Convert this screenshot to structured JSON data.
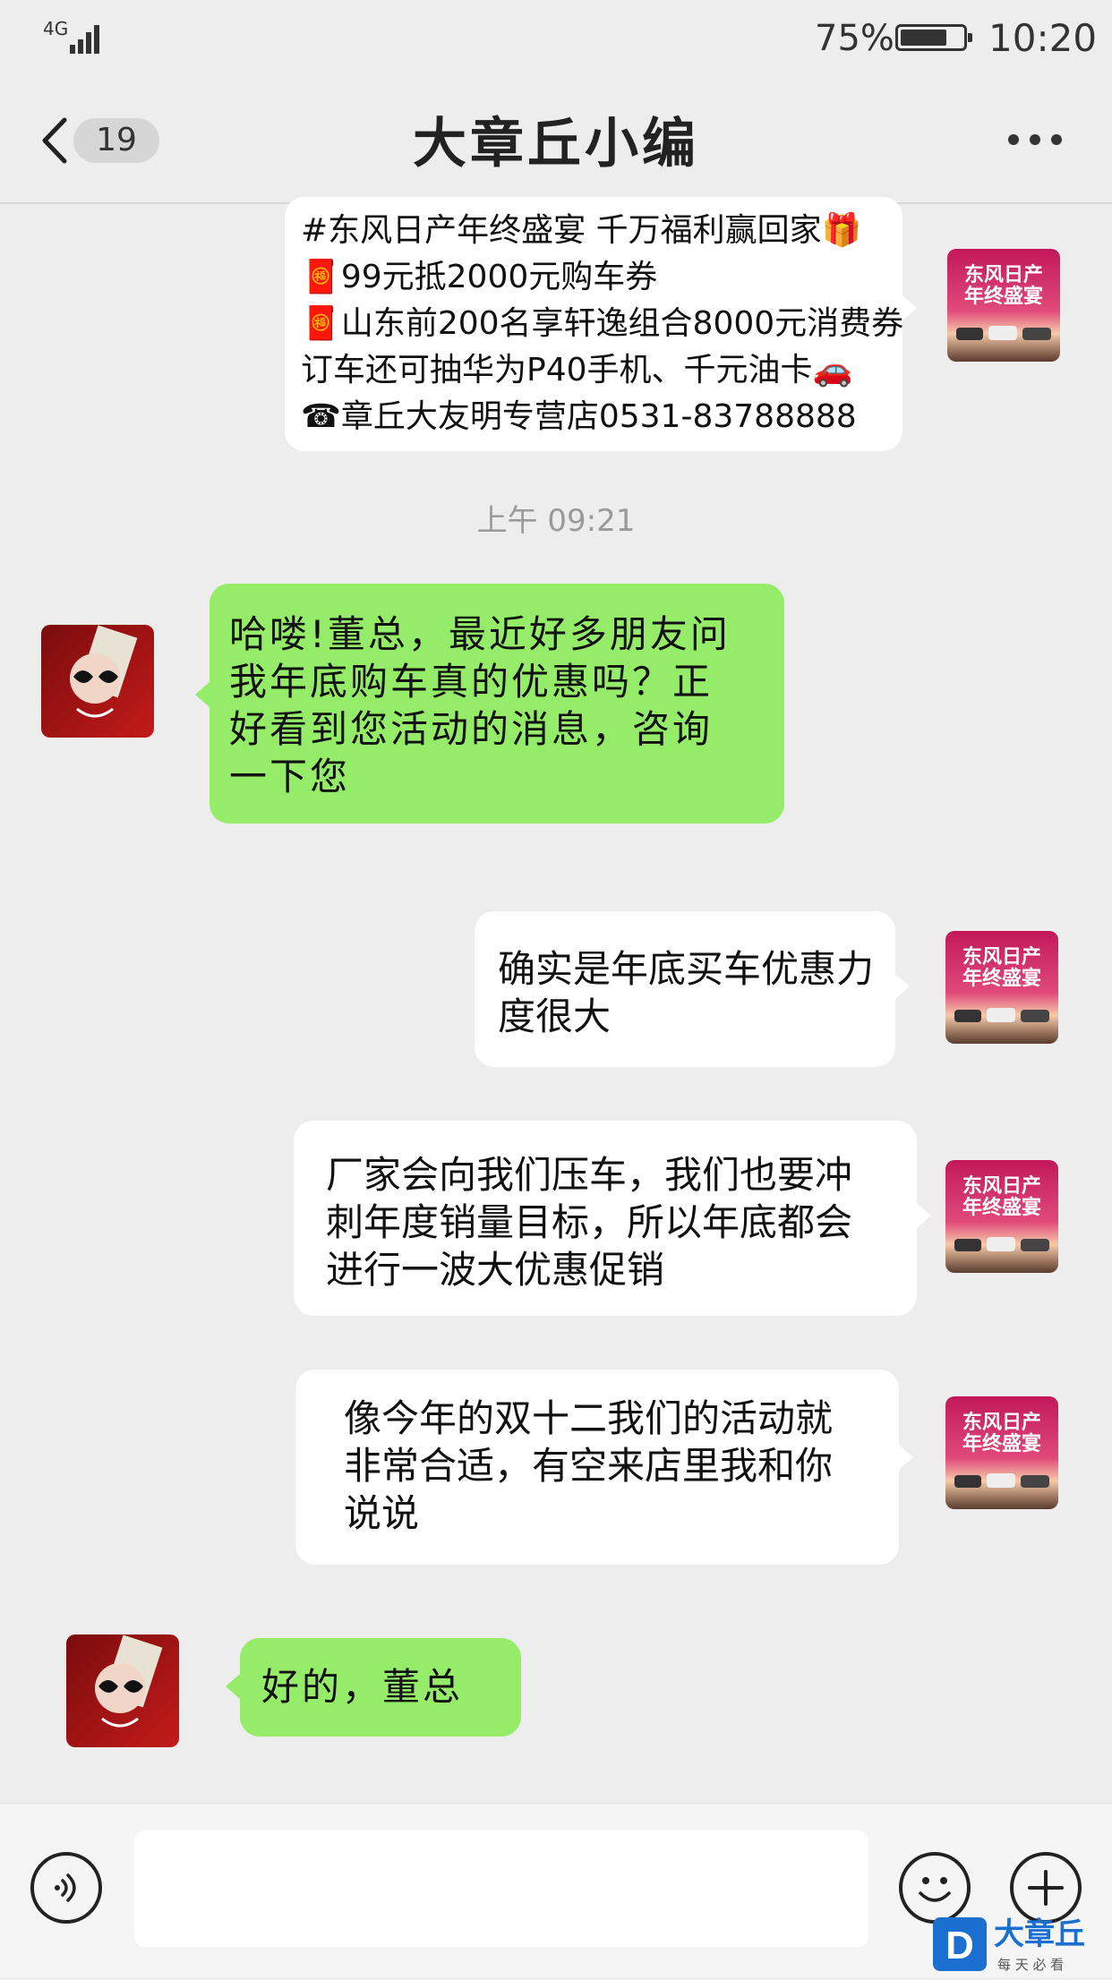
{
  "status_bar": {
    "network": "4G",
    "battery_percent_text": "75%",
    "battery_level": 0.75,
    "time": "10:20"
  },
  "nav": {
    "back_icon": "chevron-left-icon",
    "unread_count": "19",
    "title": "大章丘小编",
    "more_icon": "more-dots-icon"
  },
  "messages": [
    {
      "side": "right",
      "lines": [
        "#东风日产年终盛宴 千万福利赢回家🎁",
        "🧧99元抵2000元购车券",
        "🧧山东前200名享轩逸组合8000元消费券",
        "订车还可抽华为P40手机、千元油卡🚗",
        "☎章丘大友明专营店0531-83788888"
      ]
    },
    {
      "side": "left",
      "lines": [
        "哈喽!董总，最近好多朋友问",
        "我年底购车真的优惠吗？正",
        "好看到您活动的消息，咨询",
        "一下您"
      ]
    },
    {
      "side": "right",
      "lines": [
        "确实是年底买车优惠力",
        "度很大"
      ]
    },
    {
      "side": "right",
      "lines": [
        "厂家会向我们压车，我们也要冲",
        "刺年度销量目标，所以年底都会",
        "进行一波大优惠促销"
      ]
    },
    {
      "side": "right",
      "lines": [
        "像今年的双十二我们的活动就",
        "非常合适，有空来店里我和你",
        "说说"
      ]
    },
    {
      "side": "left",
      "lines": [
        "好的，董总"
      ]
    }
  ],
  "timestamp": "上午 09:21",
  "avatar_right_text": [
    "东风日产",
    "年终盛宴"
  ],
  "input_bar": {
    "voice_icon": "voice-icon",
    "emoji_icon": "emoji-icon",
    "plus_icon": "plus-icon",
    "input_value": ""
  },
  "watermark": {
    "logo_letter": "D",
    "brand": "大章丘",
    "slogan": "每 天 必 看"
  },
  "colors": {
    "background": "#ededed",
    "bubble_green": "#95ec69",
    "bubble_white": "#ffffff",
    "watermark_blue": "#1a6fd0"
  }
}
